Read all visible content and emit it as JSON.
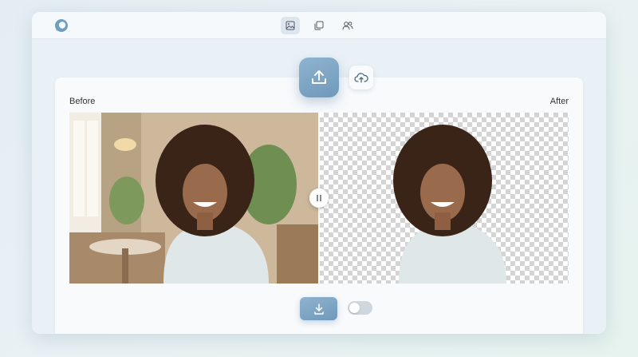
{
  "app": {
    "icons": {
      "logo": "app-logo",
      "nav_images": "image-icon",
      "nav_pages": "copy-icon",
      "nav_users": "users-icon",
      "upload": "upload-icon",
      "cloud_upload": "cloud-upload-icon",
      "compare_handle": "pause-icon",
      "download": "download-icon"
    },
    "active_nav": "images",
    "accent_color": "#7ea6c4"
  },
  "compare": {
    "before_label": "Before",
    "after_label": "After",
    "split_fraction": 0.5
  },
  "toggle": {
    "on": false
  }
}
